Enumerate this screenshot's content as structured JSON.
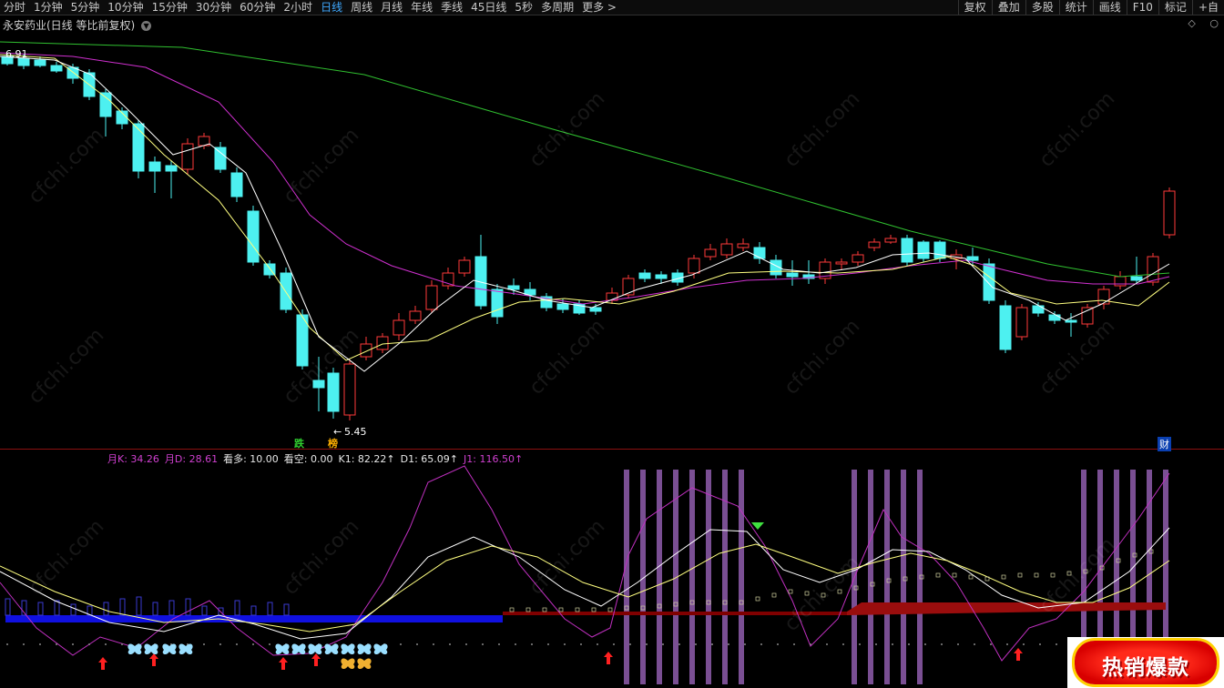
{
  "toolbar": {
    "tabs": [
      {
        "label": "分时"
      },
      {
        "label": "1分钟"
      },
      {
        "label": "5分钟"
      },
      {
        "label": "10分钟"
      },
      {
        "label": "15分钟"
      },
      {
        "label": "30分钟"
      },
      {
        "label": "60分钟"
      },
      {
        "label": "2小时"
      },
      {
        "label": "日线",
        "active": true
      },
      {
        "label": "周线"
      },
      {
        "label": "月线"
      },
      {
        "label": "年线"
      },
      {
        "label": "季线"
      },
      {
        "label": "45日线"
      },
      {
        "label": "5秒"
      },
      {
        "label": "多周期"
      },
      {
        "label": "更多 >"
      }
    ],
    "tools": [
      {
        "label": "复权"
      },
      {
        "label": "叠加"
      },
      {
        "label": "多股"
      },
      {
        "label": "统计"
      },
      {
        "label": "画线"
      },
      {
        "label": "F10"
      },
      {
        "label": "标记"
      },
      {
        "label": "+自"
      }
    ]
  },
  "stock": {
    "title": "永安药业(日线 等比前复权)",
    "menu_icon": "chevron-down-icon"
  },
  "chart": {
    "high_label": "6.91",
    "low_label": "5.45",
    "die_label": "跌",
    "bang_label": "榜",
    "cai_badge": "财",
    "colors": {
      "up": "#ff3a3a",
      "down": "#4df0f0",
      "ma1": "#ffffff",
      "ma2": "#ffff80",
      "ma3": "#d030d0",
      "ma4": "#30c030"
    }
  },
  "indicator": {
    "items": [
      {
        "text": "月K: 34.26",
        "color": "#d040d0"
      },
      {
        "text": "月D: 28.61",
        "color": "#d040d0"
      },
      {
        "text": "看多: 10.00",
        "color": "#e8e8e8"
      },
      {
        "text": "看空: 0.00",
        "color": "#e8e8e8"
      },
      {
        "text": "K1: 82.22↑",
        "color": "#e8e8e8"
      },
      {
        "text": "D1: 65.09↑",
        "color": "#e8e8e8"
      },
      {
        "text": "J1: 116.50↑",
        "color": "#d040d0"
      }
    ]
  },
  "side_icons": [
    "diamond-icon",
    "circle-icon"
  ],
  "watermark": "cfchi.com",
  "promo": "热销爆款"
}
